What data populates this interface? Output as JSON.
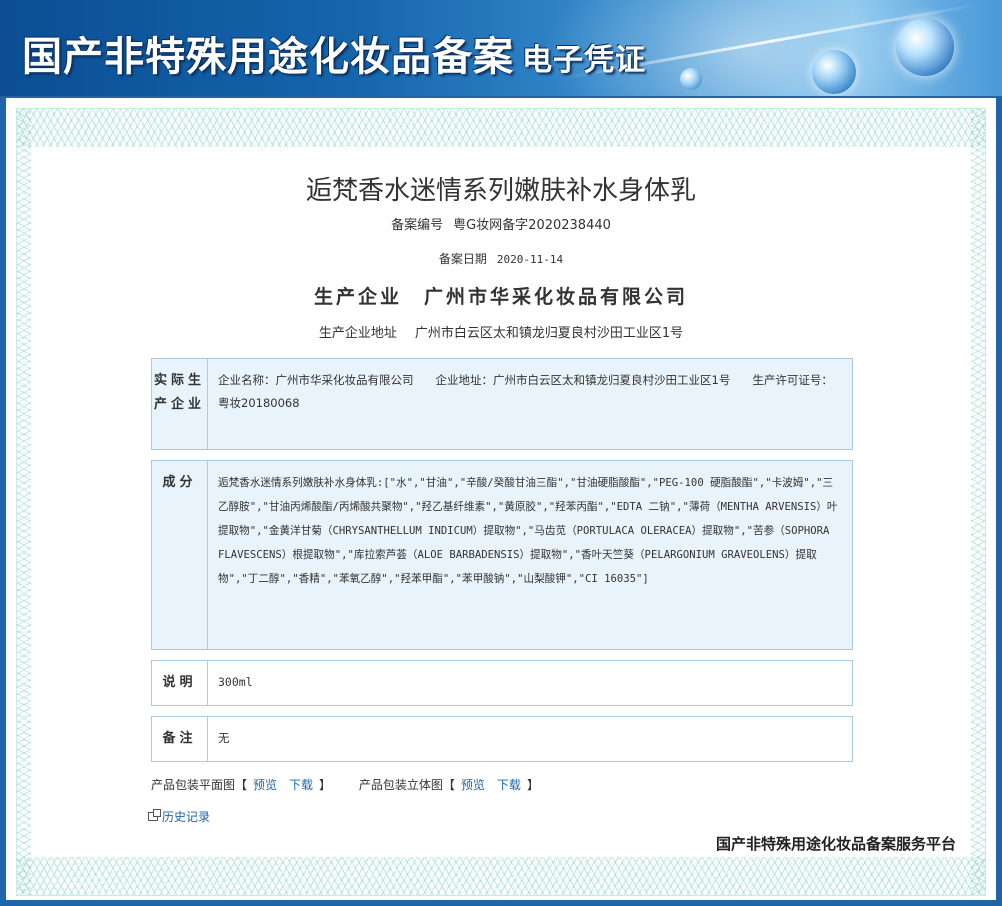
{
  "header": {
    "title": "国产非特殊用途化妆品备案",
    "subtitle": "电子凭证"
  },
  "product": {
    "name": "逅梵香水迷情系列嫩肤补水身体乳",
    "reg_label": "备案编号",
    "reg_value": "粤G妆网备字2020238440",
    "date_label": "备案日期",
    "date_value": "2020-11-14",
    "maker_label": "生产企业",
    "maker_value": "广州市华采化妆品有限公司",
    "addr_label": "生产企业地址",
    "addr_value": "广州市白云区太和镇龙归夏良村沙田工业区1号"
  },
  "actual_maker": {
    "label": "实际生产企业",
    "company": "企业名称：广州市华采化妆品有限公司",
    "address": "企业地址：广州市白云区太和镇龙归夏良村沙田工业区1号",
    "license": "生产许可证号：粤妆20180068"
  },
  "ingredients": {
    "label": "成分",
    "text": "逅梵香水迷情系列嫩肤补水身体乳:[\"水\",\"甘油\",\"辛酸/癸酸甘油三酯\",\"甘油硬脂酸酯\",\"PEG-100 硬脂酸酯\",\"卡波姆\",\"三乙醇胺\",\"甘油丙烯酸酯/丙烯酸共聚物\",\"羟乙基纤维素\",\"黄原胶\",\"羟苯丙酯\",\"EDTA 二钠\",\"薄荷（MENTHA ARVENSIS）叶提取物\",\"金黄洋甘菊（CHRYSANTHELLUM INDICUM）提取物\",\"马齿苋（PORTULACA OLERACEA）提取物\",\"苦参（SOPHORA FLAVESCENS）根提取物\",\"库拉索芦荟（ALOE BARBADENSIS）提取物\",\"香叶天竺葵（PELARGONIUM GRAVEOLENS）提取物\",\"丁二醇\",\"香精\",\"苯氧乙醇\",\"羟苯甲酯\",\"苯甲酸钠\",\"山梨酸钾\",\"CI 16035\"]"
  },
  "description": {
    "label": "说明",
    "value": "300ml"
  },
  "remark": {
    "label": "备注",
    "value": "无"
  },
  "downloads": {
    "flat_label": "产品包装平面图【",
    "flat_preview": "预览",
    "flat_download": "下载",
    "flat_close": "】",
    "solid_label": "产品包装立体图【",
    "solid_preview": "预览",
    "solid_download": "下载",
    "solid_close": "】"
  },
  "history": {
    "label": "历史记录"
  },
  "footer": {
    "brand": "国产非特殊用途化妆品备案服务平台"
  },
  "colors": {
    "header_blue": "#1f65a8",
    "link": "#1f65a8",
    "box_blue": "#e9f3fb",
    "box_border": "#a9cce3"
  }
}
